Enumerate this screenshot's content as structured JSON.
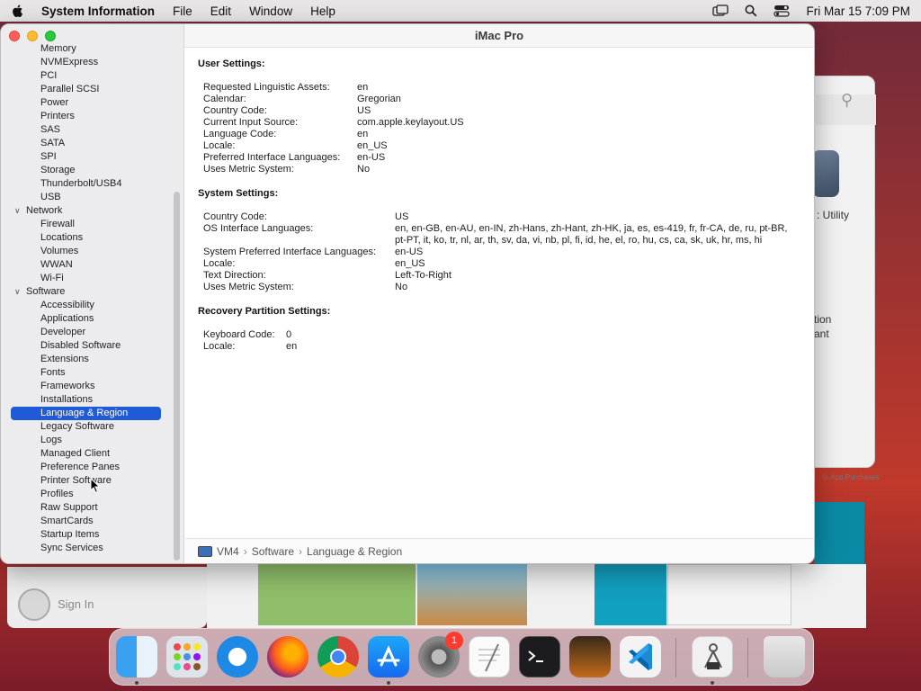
{
  "menubar": {
    "app_name": "System Information",
    "items": [
      "File",
      "Edit",
      "Window",
      "Help"
    ],
    "clock": "Fri Mar 15  7:09 PM"
  },
  "background": {
    "utility_label": ": Utility",
    "tion_label": "tion",
    "ant_label": "ant",
    "in_app": "In-App Purchases",
    "sign_in": "Sign In"
  },
  "window": {
    "title": "iMac Pro"
  },
  "sidebar": {
    "rows": [
      {
        "label": "Memory",
        "kind": "child"
      },
      {
        "label": "NVMExpress",
        "kind": "child"
      },
      {
        "label": "PCI",
        "kind": "child"
      },
      {
        "label": "Parallel SCSI",
        "kind": "child"
      },
      {
        "label": "Power",
        "kind": "child"
      },
      {
        "label": "Printers",
        "kind": "child"
      },
      {
        "label": "SAS",
        "kind": "child"
      },
      {
        "label": "SATA",
        "kind": "child"
      },
      {
        "label": "SPI",
        "kind": "child"
      },
      {
        "label": "Storage",
        "kind": "child"
      },
      {
        "label": "Thunderbolt/USB4",
        "kind": "child"
      },
      {
        "label": "USB",
        "kind": "child"
      },
      {
        "label": "Network",
        "kind": "group"
      },
      {
        "label": "Firewall",
        "kind": "child"
      },
      {
        "label": "Locations",
        "kind": "child"
      },
      {
        "label": "Volumes",
        "kind": "child"
      },
      {
        "label": "WWAN",
        "kind": "child"
      },
      {
        "label": "Wi-Fi",
        "kind": "child"
      },
      {
        "label": "Software",
        "kind": "group"
      },
      {
        "label": "Accessibility",
        "kind": "child"
      },
      {
        "label": "Applications",
        "kind": "child"
      },
      {
        "label": "Developer",
        "kind": "child"
      },
      {
        "label": "Disabled Software",
        "kind": "child"
      },
      {
        "label": "Extensions",
        "kind": "child"
      },
      {
        "label": "Fonts",
        "kind": "child"
      },
      {
        "label": "Frameworks",
        "kind": "child"
      },
      {
        "label": "Installations",
        "kind": "child"
      },
      {
        "label": "Language & Region",
        "kind": "selected"
      },
      {
        "label": "Legacy Software",
        "kind": "child"
      },
      {
        "label": "Logs",
        "kind": "child"
      },
      {
        "label": "Managed Client",
        "kind": "child"
      },
      {
        "label": "Preference Panes",
        "kind": "child"
      },
      {
        "label": "Printer Software",
        "kind": "child"
      },
      {
        "label": "Profiles",
        "kind": "child"
      },
      {
        "label": "Raw Support",
        "kind": "child"
      },
      {
        "label": "SmartCards",
        "kind": "child"
      },
      {
        "label": "Startup Items",
        "kind": "child"
      },
      {
        "label": "Sync Services",
        "kind": "child"
      }
    ]
  },
  "content": {
    "user_settings": {
      "title": "User Settings:",
      "rows": [
        {
          "k": "Requested Linguistic Assets:",
          "v": "en"
        },
        {
          "k": "Calendar:",
          "v": "Gregorian"
        },
        {
          "k": "Country Code:",
          "v": "US"
        },
        {
          "k": "Current Input Source:",
          "v": "com.apple.keylayout.US"
        },
        {
          "k": "Language Code:",
          "v": "en"
        },
        {
          "k": "Locale:",
          "v": "en_US"
        },
        {
          "k": "Preferred Interface Languages:",
          "v": "en-US"
        },
        {
          "k": "Uses Metric System:",
          "v": "No"
        }
      ]
    },
    "system_settings": {
      "title": "System Settings:",
      "rows": [
        {
          "k": "Country Code:",
          "v": "US"
        },
        {
          "k": "OS Interface Languages:",
          "v": "en, en-GB, en-AU, en-IN, zh-Hans, zh-Hant, zh-HK, ja, es, es-419, fr, fr-CA, de, ru, pt-BR, pt-PT, it, ko, tr, nl, ar, th, sv, da, vi, nb, pl, fi, id, he, el, ro, hu, cs, ca, sk, uk, hr, ms, hi"
        },
        {
          "k": "System Preferred Interface Languages:",
          "v": "en-US"
        },
        {
          "k": "Locale:",
          "v": "en_US"
        },
        {
          "k": "Text Direction:",
          "v": "Left-To-Right"
        },
        {
          "k": "Uses Metric System:",
          "v": "No"
        }
      ]
    },
    "recovery_settings": {
      "title": "Recovery Partition Settings:",
      "rows": [
        {
          "k": "Keyboard Code:",
          "v": "0"
        },
        {
          "k": "Locale:",
          "v": "en"
        }
      ]
    }
  },
  "pathbar": {
    "segments": [
      "VM4",
      "Software",
      "Language & Region"
    ]
  },
  "dock": {
    "apps": [
      "finder",
      "launchpad",
      "safari",
      "firefox",
      "chrome",
      "app-store",
      "system-preferences",
      "textedit",
      "terminal",
      "garageband",
      "vscode",
      "system-information",
      "trash"
    ],
    "badge": "1"
  }
}
